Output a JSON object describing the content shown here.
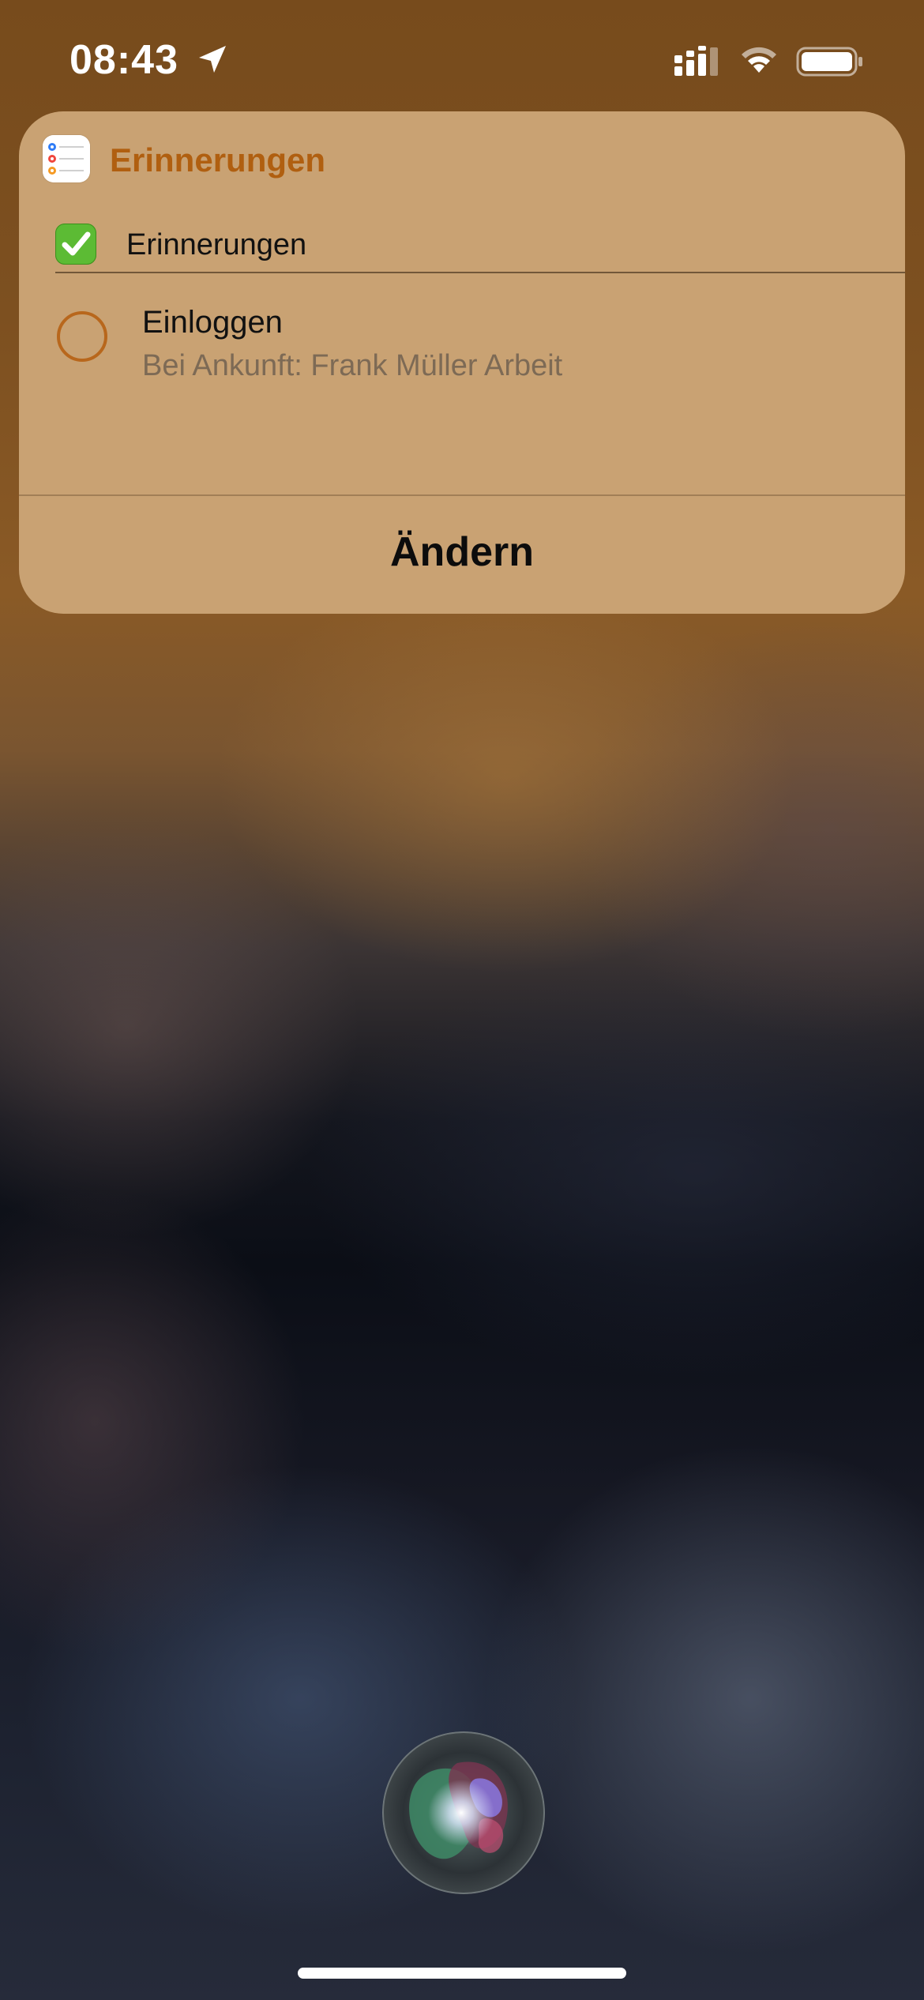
{
  "status_bar": {
    "time": "08:43",
    "icons": [
      "location-arrow-icon",
      "cellular-signal-icon",
      "wifi-icon",
      "battery-icon"
    ]
  },
  "card": {
    "app_name": "Erinnerungen",
    "app_icon": "reminders-app-icon",
    "list": {
      "emoji": "check-mark-button-icon",
      "name": "Erinnerungen"
    },
    "reminder": {
      "title": "Einloggen",
      "subtitle": "Bei Ankunft: Frank Müller Arbeit"
    },
    "edit_button_label": "Ändern"
  },
  "colors": {
    "card_background": "#c9a273",
    "app_title": "#b05f10",
    "reminder_circle": "#b8671c",
    "subtitle_text": "#7d6a55"
  },
  "siri": {
    "icon": "siri-orb-icon"
  }
}
